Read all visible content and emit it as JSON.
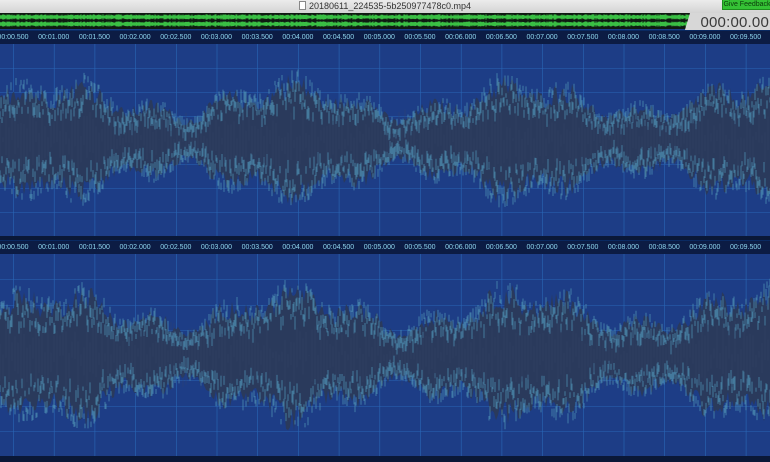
{
  "window": {
    "title": "20180611_224535-5b250977478c0.mp4",
    "file_icon": "document-icon"
  },
  "feedback_label": "Give Feedback",
  "timer": "000:00.00",
  "ruler_labels": [
    "00:00.500",
    "00:01.000",
    "00:01.500",
    "00:02.000",
    "00:02.500",
    "00:03.000",
    "00:03.500",
    "00:04.000",
    "00:04.500",
    "00:05.000",
    "00:05.500",
    "00:06.000",
    "00:06.500",
    "00:07.000",
    "00:07.500",
    "00:08.000",
    "00:08.500",
    "00:09.000",
    "00:09.500"
  ],
  "colors": {
    "background": "#1d3d86",
    "waveform_fill": "#2a3a5c",
    "waveform_stroke": "#4f93b6",
    "grid": "#2c6fbf",
    "overview_wave": "#3fd14a",
    "ruler_text": "#8fd6ee"
  }
}
